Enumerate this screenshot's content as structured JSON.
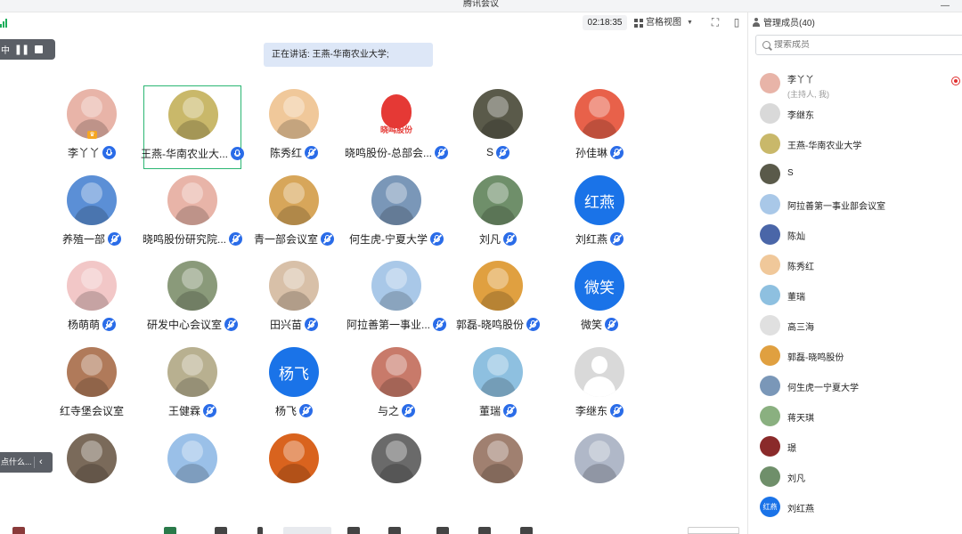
{
  "window": {
    "title": "腾讯会议"
  },
  "toolbar": {
    "timer": "02:18:35",
    "view_label": "宫格视图"
  },
  "recording": {
    "label": "中"
  },
  "speaking": {
    "text": "正在讲话: 王燕-华南农业大学;"
  },
  "grid": {
    "tiles": [
      {
        "name": "李丫丫",
        "mic": "on",
        "avatar": "photo",
        "color": "#e8b4a8",
        "host": true
      },
      {
        "name": "王燕-华南农业大...",
        "mic": "on",
        "avatar": "photo",
        "color": "#c9b86a",
        "active": true
      },
      {
        "name": "陈秀红",
        "mic": "off",
        "avatar": "photo",
        "color": "#f0c89a"
      },
      {
        "name": "晓鸣股份-总部会...",
        "mic": "off",
        "avatar": "logo",
        "color": "#e53935",
        "logo_text": "晓鸣股份"
      },
      {
        "name": "S",
        "mic": "off",
        "avatar": "photo",
        "color": "#5a5a4a"
      },
      {
        "name": "孙佳琳",
        "mic": "off",
        "avatar": "photo",
        "color": "#e8614a"
      },
      {
        "name": "养殖一部",
        "mic": "off",
        "avatar": "photo",
        "color": "#5b8fd6"
      },
      {
        "name": "晓鸣股份研究院...",
        "mic": "off",
        "avatar": "photo",
        "color": "#e8b4a8"
      },
      {
        "name": "青一部会议室",
        "mic": "off",
        "avatar": "photo",
        "color": "#d7a65a"
      },
      {
        "name": "何生虎-宁夏大学",
        "mic": "off",
        "avatar": "photo",
        "color": "#7a97b8"
      },
      {
        "name": "刘凡",
        "mic": "off",
        "avatar": "photo",
        "color": "#6f8f6a"
      },
      {
        "name": "刘红燕",
        "mic": "off",
        "avatar": "text",
        "color": "#1a73e8",
        "text": "红燕"
      },
      {
        "name": "杨萌萌",
        "mic": "off",
        "avatar": "photo",
        "color": "#f2c7c7"
      },
      {
        "name": "研发中心会议室",
        "mic": "off",
        "avatar": "photo",
        "color": "#8a9a7a"
      },
      {
        "name": "田兴苗",
        "mic": "off",
        "avatar": "photo",
        "color": "#d8c0a8"
      },
      {
        "name": "阿拉善第一事业...",
        "mic": "off",
        "avatar": "photo",
        "color": "#a9c8e8"
      },
      {
        "name": "郭磊-晓鸣股份",
        "mic": "off",
        "avatar": "photo",
        "color": "#e0a040"
      },
      {
        "name": "微笑",
        "mic": "off",
        "avatar": "text",
        "color": "#1a73e8",
        "text": "微笑"
      },
      {
        "name": "红寺堡会议室",
        "mic": "none",
        "avatar": "photo",
        "color": "#b07a5a"
      },
      {
        "name": "王健霖",
        "mic": "off",
        "avatar": "photo",
        "color": "#b8b090"
      },
      {
        "name": "杨飞",
        "mic": "off",
        "avatar": "text",
        "color": "#1a73e8",
        "text": "杨飞"
      },
      {
        "name": "与之",
        "mic": "off",
        "avatar": "photo",
        "color": "#c87a6a"
      },
      {
        "name": "董瑞",
        "mic": "off",
        "avatar": "photo",
        "color": "#8ec0e0"
      },
      {
        "name": "李继东",
        "mic": "off",
        "avatar": "default",
        "color": "#d9d9d9"
      },
      {
        "name": "",
        "mic": "none",
        "avatar": "photo",
        "color": "#7a6a5a"
      },
      {
        "name": "",
        "mic": "none",
        "avatar": "photo",
        "color": "#9ac0e8"
      },
      {
        "name": "",
        "mic": "none",
        "avatar": "photo",
        "color": "#d9631e"
      },
      {
        "name": "",
        "mic": "none",
        "avatar": "photo",
        "color": "#6a6a6a"
      },
      {
        "name": "",
        "mic": "none",
        "avatar": "photo",
        "color": "#a08070"
      },
      {
        "name": "",
        "mic": "none",
        "avatar": "photo",
        "color": "#b0b8c8"
      }
    ]
  },
  "chat_tab": {
    "label": "点什么..."
  },
  "panel": {
    "title": "管理成员(40)",
    "search_placeholder": "搜索成员",
    "members": [
      {
        "name": "李丫丫",
        "sub": "(主持人, 我)",
        "color": "#e8b4a8",
        "host": true
      },
      {
        "name": "李继东",
        "color": "#d9d9d9"
      },
      {
        "name": "王燕-华南农业大学",
        "color": "#c9b86a"
      },
      {
        "name": "S",
        "color": "#5a5a4a"
      },
      {
        "name": "阿拉善第一事业部会议室",
        "color": "#a9c8e8"
      },
      {
        "name": "陈灿",
        "color": "#4a66a8"
      },
      {
        "name": "陈秀红",
        "color": "#f0c89a"
      },
      {
        "name": "董瑞",
        "color": "#8ec0e0"
      },
      {
        "name": "高三海",
        "color": "#e0e0e0"
      },
      {
        "name": "郭磊-晓鸣股份",
        "color": "#e0a040"
      },
      {
        "name": "何生虎一宁夏大学",
        "color": "#7a97b8"
      },
      {
        "name": "蒋天琪",
        "color": "#8ab080"
      },
      {
        "name": "璟",
        "color": "#8a2a2a"
      },
      {
        "name": "刘凡",
        "color": "#6f8f6a"
      },
      {
        "name": "刘红燕",
        "color": "#1a73e8",
        "text": "红燕"
      }
    ]
  }
}
